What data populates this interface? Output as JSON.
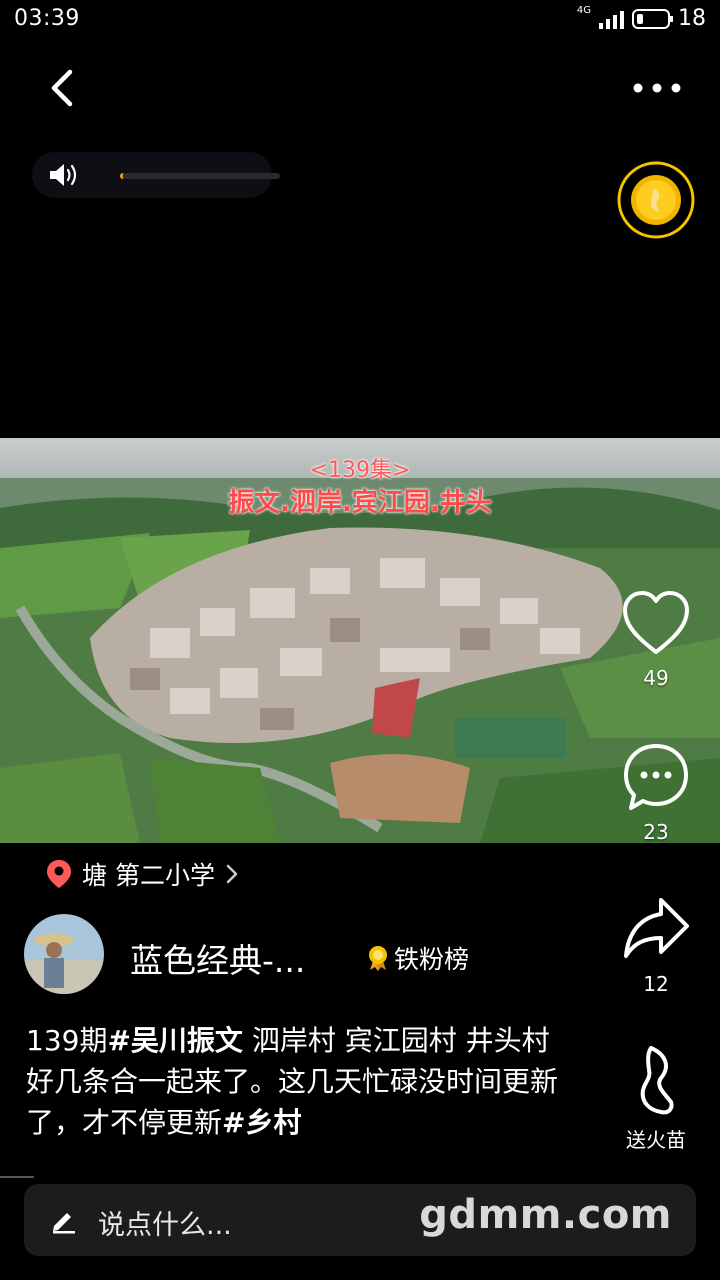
{
  "status_bar": {
    "time": "03:39",
    "network": "4G",
    "battery": "18"
  },
  "volume": {
    "level": 0.02
  },
  "video": {
    "overlay_episode": "<139集>",
    "overlay_title": "振文.泗岸.宾江园.井头"
  },
  "actions": {
    "like_count": "49",
    "comment_count": "23",
    "share_count": "12",
    "fire_label": "送火苗"
  },
  "location": {
    "text": "塘 第二小学"
  },
  "author": {
    "name": "蓝色经典-...",
    "fan_rank_label": "铁粉榜"
  },
  "description": {
    "prefix": "139期",
    "tag1": "#吴川振文",
    "body": "  泗岸村 宾江园村 井头村 好几条合一起来了。这几天忙碌没时间更新了，才不停更新",
    "tag2": "#乡村"
  },
  "comment": {
    "placeholder": "说点什么...",
    "watermark": "gdmm.com"
  },
  "colors": {
    "background": "#000000",
    "accent_gold": "#f5c400",
    "pin_red": "#ff5a5a"
  }
}
